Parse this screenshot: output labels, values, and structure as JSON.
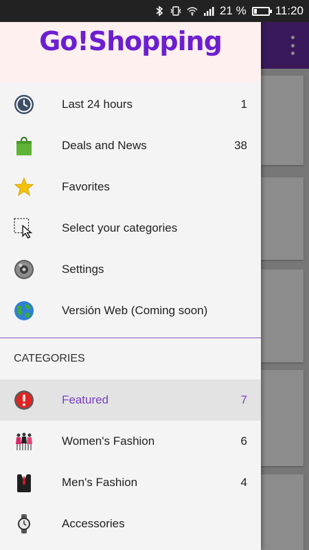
{
  "status_bar": {
    "battery_percent": "21 %",
    "battery_level": 0.21,
    "time": "11:20",
    "icons": [
      "bluetooth-icon",
      "vibrate-icon",
      "wifi-icon",
      "signal-icon"
    ]
  },
  "drawer": {
    "logo": "Go!Shopping",
    "menu": [
      {
        "label": "Last 24 hours",
        "count": "1",
        "icon": "clock-icon"
      },
      {
        "label": "Deals and News",
        "count": "38",
        "icon": "shopping-bag-icon"
      },
      {
        "label": "Favorites",
        "count": "",
        "icon": "star-icon"
      },
      {
        "label": "Select your categories",
        "count": "",
        "icon": "selection-cursor-icon"
      },
      {
        "label": "Settings",
        "count": "",
        "icon": "settings-icon"
      },
      {
        "label": "Versión Web (Coming soon)",
        "count": "",
        "icon": "globe-icon"
      }
    ],
    "categories_header": "CATEGORIES",
    "categories": [
      {
        "label": "Featured",
        "count": "7",
        "icon": "alert-icon",
        "selected": true
      },
      {
        "label": "Women's Fashion",
        "count": "6",
        "icon": "women-fashion-icon"
      },
      {
        "label": "Men's Fashion",
        "count": "4",
        "icon": "suit-icon"
      },
      {
        "label": "Accessories",
        "count": "",
        "icon": "watch-icon"
      }
    ]
  },
  "colors": {
    "accent": "#7a3fc4",
    "toolbar": "#6a2fa5",
    "logo": "#6c1fd0"
  }
}
